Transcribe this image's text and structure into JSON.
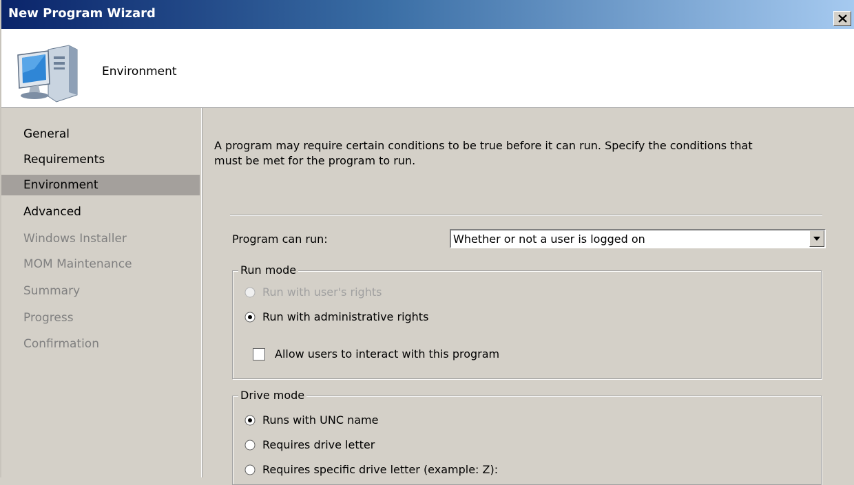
{
  "window": {
    "title": "New Program Wizard",
    "close_label": "×"
  },
  "header": {
    "icon": "computer-icon",
    "title": "Environment"
  },
  "nav": {
    "items": [
      {
        "label": "General",
        "state": "enabled"
      },
      {
        "label": "Requirements",
        "state": "enabled"
      },
      {
        "label": "Environment",
        "state": "selected"
      },
      {
        "label": "Advanced",
        "state": "enabled"
      },
      {
        "label": "Windows Installer",
        "state": "disabled"
      },
      {
        "label": "MOM Maintenance",
        "state": "disabled"
      },
      {
        "label": "Summary",
        "state": "disabled"
      },
      {
        "label": "Progress",
        "state": "disabled"
      },
      {
        "label": "Confirmation",
        "state": "disabled"
      }
    ]
  },
  "content": {
    "description_line1": "A program may require certain conditions to be true before it can run. Specify the conditions that",
    "description_line2": "must be met for the program to run.",
    "program_can_run_label": "Program can run:",
    "program_can_run_value": "Whether or not a user is logged on",
    "run_mode": {
      "title": "Run mode",
      "options": [
        {
          "label": "Run with user's rights",
          "selected": false,
          "disabled": true
        },
        {
          "label": "Run with administrative rights",
          "selected": true,
          "disabled": false
        }
      ],
      "checkbox_label": "Allow users to interact with this program",
      "checkbox_checked": false
    },
    "drive_mode": {
      "title": "Drive mode",
      "options": [
        {
          "label": "Runs with UNC name",
          "selected": true
        },
        {
          "label": "Requires drive letter",
          "selected": false
        },
        {
          "label": "Requires specific drive letter (example: Z):",
          "selected": false
        }
      ]
    }
  }
}
